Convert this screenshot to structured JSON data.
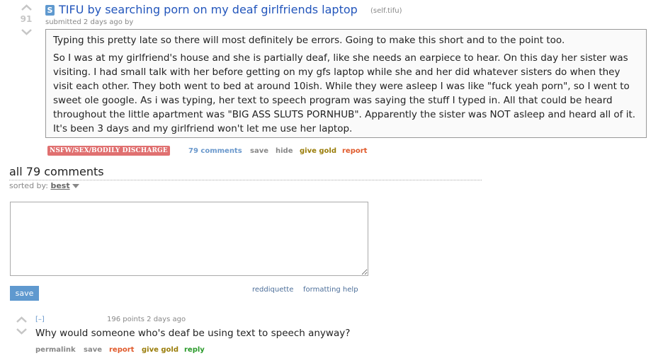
{
  "post": {
    "score": "91",
    "self_icon": "S",
    "title": "TIFU by searching porn on my deaf girlfriends laptop",
    "domain": "(self.tifu)",
    "tagline": "submitted 2 days ago by",
    "selftext": [
      "Typing this pretty late so there will most definitely be errors. Going to make this short and to the point too.",
      "So I was at my girlfriend's house and she is partially deaf, like she needs an earpiece to hear. On this day her sister was visiting. I had small talk with her before getting on my gfs laptop while she and her did whatever sisters do when they visit each other. They both went to bed at around 10ish. While they were asleep I was like \"fuck yeah porn\", so I went to sweet ole google. As i was typing, her text to speech program was saying the stuff I typed in. All that could be heard throughout the little apartment was \"BIG ASS SLUTS PORNHUB\". Apparently the sister was NOT asleep and heard all of it. It's been 3 days and my girlfriend won't let me use her laptop."
    ],
    "flair": "NSFW/SEX/BODILY DISCHARGE",
    "buttons": {
      "comments": "79 comments",
      "save": "save",
      "hide": "hide",
      "give_gold": "give gold",
      "report": "report"
    }
  },
  "comments_area": {
    "heading": "all 79 comments",
    "sorted_by_label": "sorted by:",
    "sort_value": "best",
    "save_label": "save",
    "reddiquette": "reddiquette",
    "formatting_help": "formatting help"
  },
  "comment": {
    "collapse": "[–]",
    "meta": "196 points 2 days ago",
    "body": "Why would someone who's deaf be using text to speech anyway?",
    "buttons": {
      "permalink": "permalink",
      "save": "save",
      "report": "report",
      "give_gold": "give gold",
      "reply": "reply"
    }
  },
  "icons": [
    "upvote-arrow-icon",
    "downvote-arrow-icon",
    "self-post-icon",
    "dropdown-caret-icon"
  ],
  "colors": {
    "link_blue": "#2255bb",
    "nsfw_flair": "#e07070",
    "save_button": "#5f99cf",
    "gold": "#9a7d0a",
    "report_red": "#e0592a",
    "reply_green": "#2a9a2a"
  }
}
